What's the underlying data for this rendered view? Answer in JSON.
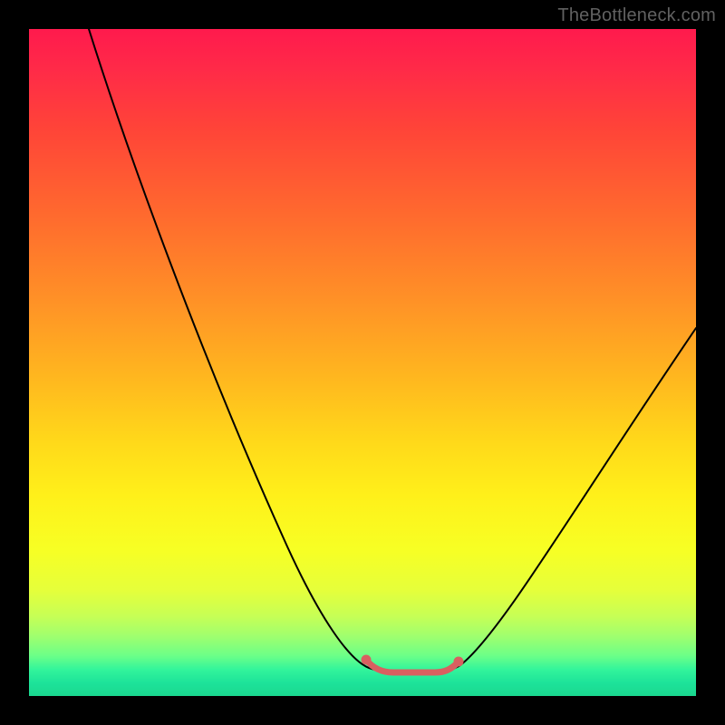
{
  "watermark": "TheBottleneck.com",
  "chart_data": {
    "type": "line",
    "title": "",
    "xlabel": "",
    "ylabel": "",
    "xlim": [
      0,
      100
    ],
    "ylim": [
      0,
      100
    ],
    "grid": false,
    "legend": false,
    "note": "Axes are unlabeled percentage-style; values are estimated from pixel positions.",
    "series": [
      {
        "name": "curve",
        "color": "#000000",
        "x": [
          9,
          12,
          16,
          20,
          24,
          28,
          32,
          36,
          40,
          44,
          48,
          51,
          53,
          55,
          58,
          61,
          64,
          68,
          72,
          76,
          80,
          84,
          88,
          92,
          96,
          100
        ],
        "y": [
          100,
          91,
          82,
          73,
          64,
          56,
          47,
          39,
          31,
          23,
          15,
          9,
          6,
          5,
          4,
          4,
          5,
          8,
          13,
          19,
          25,
          31,
          37,
          43,
          49,
          55
        ]
      },
      {
        "name": "highlight",
        "color": "#d96060",
        "x": [
          51,
          53,
          55,
          57,
          59,
          61,
          63
        ],
        "y": [
          6,
          4.5,
          4,
          4,
          4,
          4.5,
          6
        ]
      }
    ]
  }
}
